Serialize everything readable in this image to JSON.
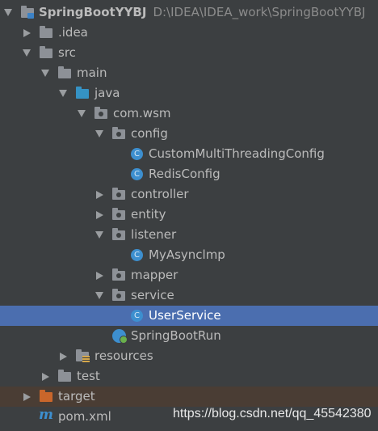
{
  "tree": {
    "root": {
      "name": "SpringBootYYBJ",
      "path": "D:\\IDEA\\IDEA_work\\SpringBootYYBJ"
    },
    "items": {
      "idea": ".idea",
      "src": "src",
      "main": "main",
      "java": "java",
      "com_wsm": "com.wsm",
      "config": "config",
      "custom_multi": "CustomMultiThreadingConfig",
      "redis_config": "RedisConfig",
      "controller": "controller",
      "entity": "entity",
      "listener": "listener",
      "my_async": "MyAsynclmp",
      "mapper": "mapper",
      "service": "service",
      "user_service": "UserService",
      "spring_boot_run": "SpringBootRun",
      "resources": "resources",
      "test": "test",
      "target": "target",
      "pom": "pom.xml"
    }
  },
  "icons": {
    "class_letter": "C",
    "maven_letter": "m"
  },
  "watermark": "https://blog.csdn.net/qq_45542380",
  "colors": {
    "background": "#3c3f41",
    "selection": "#4b6eaf",
    "source_folder": "#3592c4",
    "excluded_folder": "#c9662b",
    "class_icon": "#3d8fcf"
  }
}
